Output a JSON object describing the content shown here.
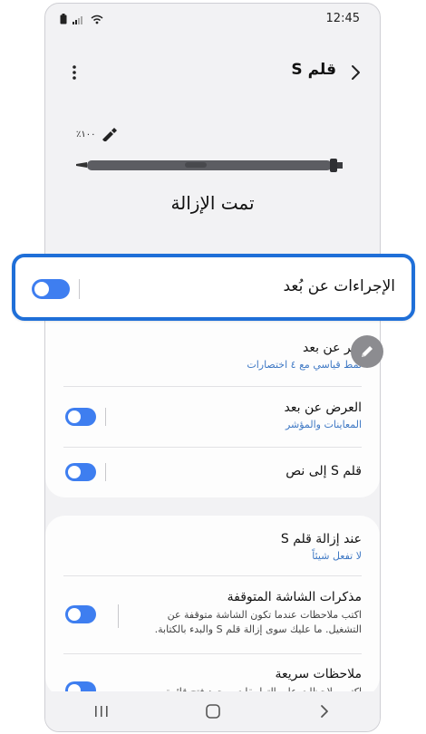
{
  "status": {
    "time": "12:45"
  },
  "header": {
    "title": "قلم S"
  },
  "pen": {
    "battery": "١٠٠٪"
  },
  "pen_status": "تمت الإزالة",
  "air_actions": {
    "label": "الإجراءات عن بُعد",
    "enabled": true
  },
  "settings_card1": [
    {
      "title": "أمر عن بعد",
      "subtitle": "نمط قياسي مع ٤ اختصارات"
    },
    {
      "title": "العرض عن بعد",
      "subtitle": "المعاينات والمؤشر",
      "toggle": true
    },
    {
      "title": "قلم S إلى نص",
      "toggle": true
    }
  ],
  "settings_card2": [
    {
      "title": "عند إزالة قلم S",
      "subtitle": "لا تفعل شيئاً"
    },
    {
      "title": "مذكرات الشاشة المتوقفة",
      "description": "اكتب ملاحظات عندما تكون الشاشة متوقفة عن التشغيل. ما عليك سوى إزالة قلم S والبدء بالكتابة.",
      "toggle": true
    },
    {
      "title": "ملاحظات سريعة",
      "description": "اكتب ملاحظات على التطبيقات بمجرد فتح قائمة...",
      "toggle": true
    }
  ],
  "colors": {
    "accent": "#3e7ef0",
    "highlight_border": "#1f6fd8",
    "link": "#3e78c4"
  }
}
